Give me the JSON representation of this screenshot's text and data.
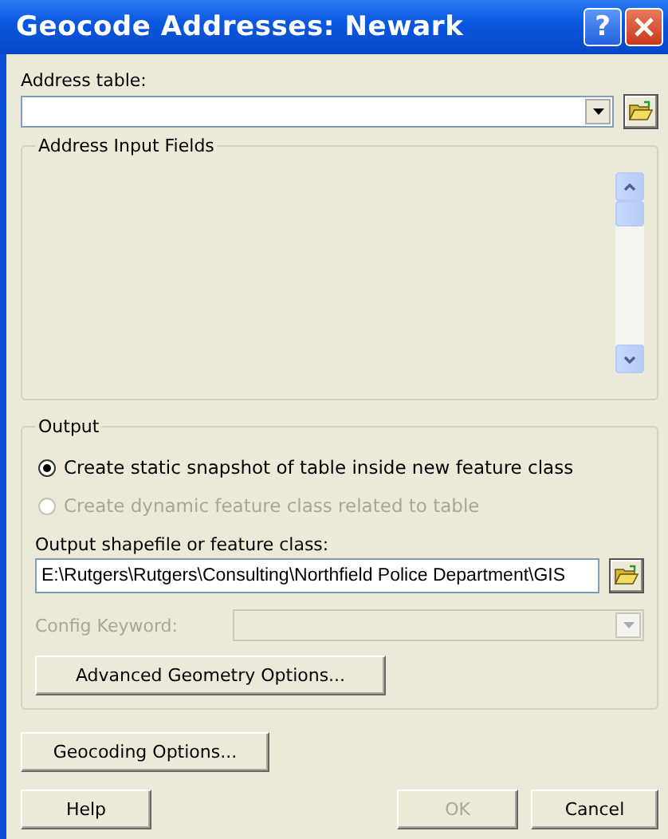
{
  "window": {
    "title": "Geocode Addresses:  Newark",
    "help_glyph": "?"
  },
  "address_table": {
    "label": "Address table:"
  },
  "address_input_fields": {
    "title": "Address Input Fields"
  },
  "output": {
    "title": "Output",
    "options": [
      {
        "label": "Create static snapshot of table inside new feature class",
        "selected": true,
        "disabled": false
      },
      {
        "label": "Create dynamic feature class related to table",
        "selected": false,
        "disabled": true
      }
    ],
    "shapefile_label": "Output shapefile or feature class:",
    "shapefile_value": "E:\\Rutgers\\Rutgers\\Consulting\\Northfield Police Department\\GIS",
    "config_keyword": {
      "label": "Config Keyword:",
      "disabled": true
    },
    "advanced_button": "Advanced Geometry Options..."
  },
  "geocoding_button": "Geocoding Options...",
  "buttons": [
    {
      "label": "Help",
      "disabled": false
    },
    {
      "label": "OK",
      "disabled": true
    },
    {
      "label": "Cancel",
      "disabled": false
    }
  ]
}
